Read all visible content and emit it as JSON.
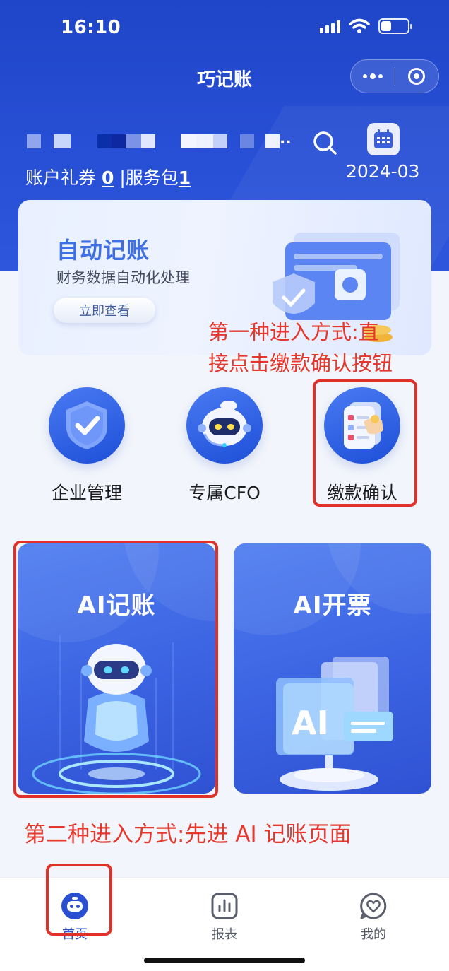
{
  "status": {
    "time": "16:10"
  },
  "nav": {
    "title": "巧记账"
  },
  "account": {
    "coupon_label": "账户礼券",
    "coupon_count": "0",
    "separator": "|",
    "service_label": "服务包",
    "service_count": "1",
    "mask_ellipsis": "..",
    "month": "2024-03"
  },
  "banner": {
    "title": "自动记账",
    "subtitle": "财务数据自动化处理",
    "button": "立即查看"
  },
  "annotations": {
    "first": [
      "第一种进入方式:直",
      "接点击缴款确认按钮"
    ],
    "second": "第二种进入方式:先进 AI 记账页面"
  },
  "features": [
    {
      "label": "企业管理",
      "icon": "shield-check-icon"
    },
    {
      "label": "专属CFO",
      "icon": "robot-icon"
    },
    {
      "label": "缴款确认",
      "icon": "payment-confirm-icon"
    }
  ],
  "cards": [
    {
      "title": "AI记账",
      "icon": "ai-robot-illustration"
    },
    {
      "title": "AI开票",
      "icon": "ai-invoice-illustration"
    }
  ],
  "tabs": [
    {
      "label": "首页",
      "icon": "home-robot-icon",
      "active": true
    },
    {
      "label": "报表",
      "icon": "chart-icon",
      "active": false
    },
    {
      "label": "我的",
      "icon": "heart-profile-icon",
      "active": false
    }
  ],
  "colors": {
    "brand": "#2850d6",
    "annotation": "#e5372b",
    "active_tab": "#2a4fd0"
  }
}
